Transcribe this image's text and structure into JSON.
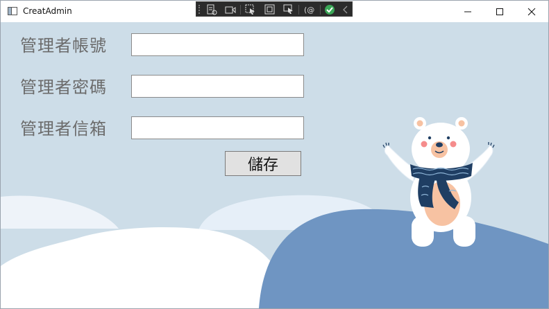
{
  "window": {
    "title": "CreatAdmin"
  },
  "form": {
    "admin_account_label": "管理者帳號",
    "admin_password_label": "管理者密碼",
    "admin_email_label": "管理者信箱",
    "admin_account_value": "",
    "admin_password_value": "",
    "admin_email_value": "",
    "save_label": "儲存"
  },
  "colors": {
    "background": "#cddde8",
    "hill": "#6f95c2",
    "snow": "#ffffff",
    "scarf": "#1f3e63",
    "belly": "#f7c2a2"
  },
  "icons": [
    "app-icon",
    "minimize-icon",
    "maximize-icon",
    "close-icon",
    "select-element-icon",
    "track-focus-icon",
    "display-adorners-icon",
    "hot-reload-icon"
  ]
}
